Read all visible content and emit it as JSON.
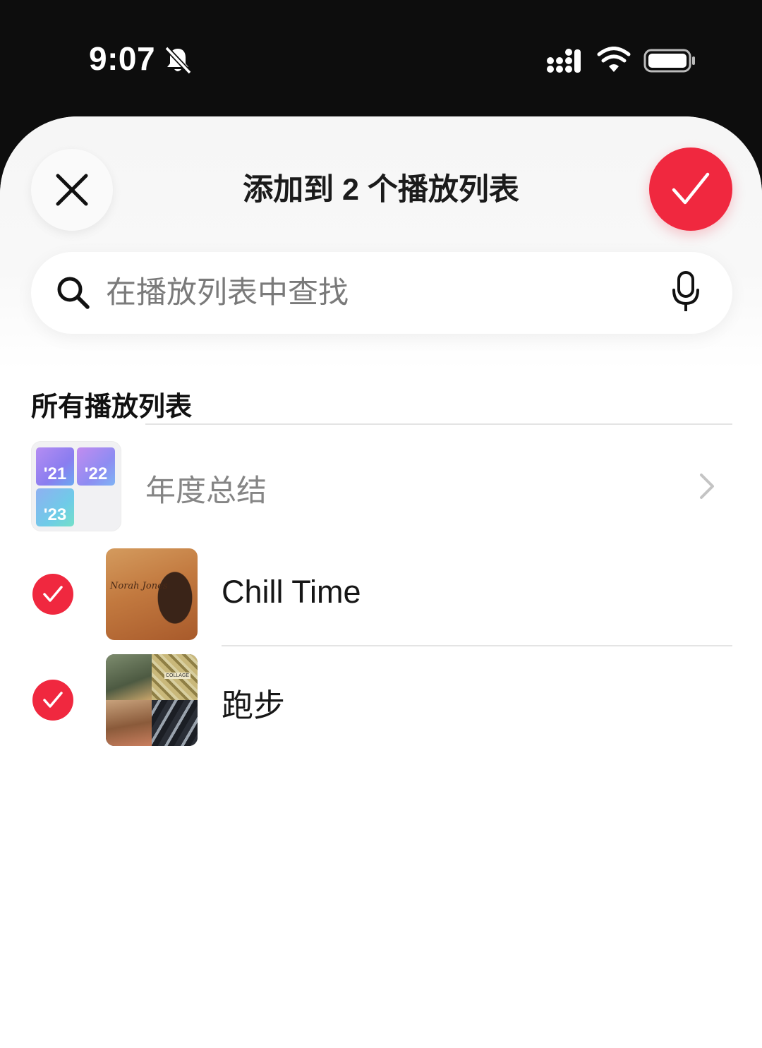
{
  "status_bar": {
    "time": "9:07",
    "icons": [
      "bell-slash-icon",
      "cellular-signal-icon",
      "wifi-icon",
      "battery-icon"
    ]
  },
  "header": {
    "title": "添加到 2 个播放列表",
    "close_icon": "close-icon",
    "confirm_icon": "checkmark-icon"
  },
  "search": {
    "placeholder": "在播放列表中查找",
    "value": "",
    "left_icon": "search-icon",
    "right_icon": "microphone-icon"
  },
  "section_title": "所有播放列表",
  "folder": {
    "label": "年度总结",
    "tiles": [
      "'21",
      "'22",
      "'23"
    ],
    "icon": "chevron-right-icon"
  },
  "playlists": [
    {
      "label": "Chill Time",
      "selected": true,
      "art_text": "Norah Jones"
    },
    {
      "label": "跑步",
      "selected": true,
      "art_text": "COLLAGE"
    }
  ],
  "colors": {
    "accent": "#f0283f",
    "background": "#ffffff",
    "status_bar": "#0d0d0d"
  }
}
